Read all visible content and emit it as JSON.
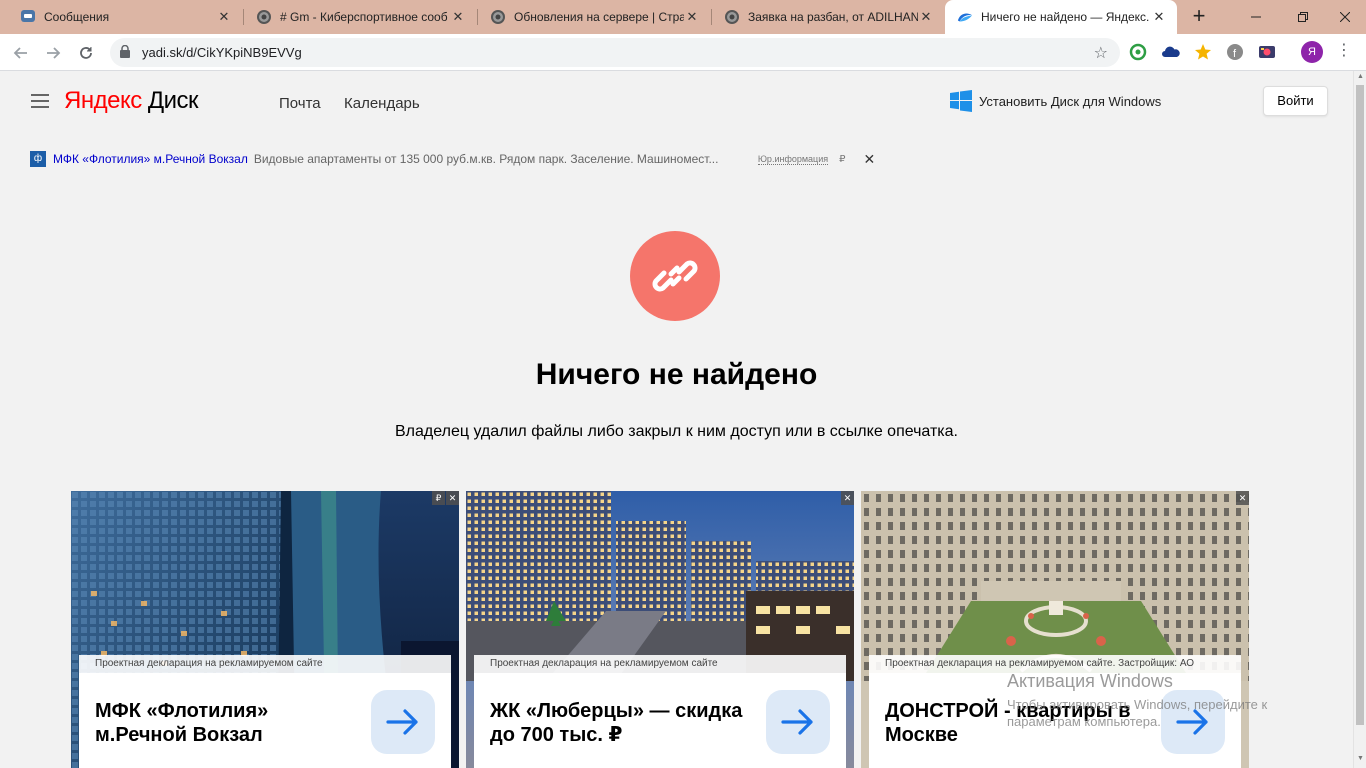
{
  "browser": {
    "tabs": [
      {
        "title": "Сообщения",
        "icon": "chat-icon"
      },
      {
        "title": "# Gm - Киберспортивное сооб",
        "icon": "globe-icon"
      },
      {
        "title": "Обновления на сервере | Стра",
        "icon": "globe-icon"
      },
      {
        "title": "Заявка на разбан, от ADILHAN",
        "icon": "globe-icon"
      },
      {
        "title": "Ничего не найдено — Яндекс.",
        "icon": "yandex-disk-icon",
        "active": true
      }
    ],
    "url": "yadi.sk/d/CikYKpiNB9EVVg",
    "profile_initial": "Я",
    "accent": "#dcb5a4"
  },
  "header": {
    "logo_yandex": "Яндекс",
    "logo_disk": "Диск",
    "nav": [
      "Почта",
      "Календарь"
    ],
    "install_label": "Установить Диск для Windows",
    "login_label": "Войти"
  },
  "text_ad": {
    "favicon_letter": "ф",
    "title": "МФК «Флотилия» м.Речной Вокзал",
    "text": "Видовые апартаменты от 135 000 руб.м.кв. Рядом парк. Заселение. Машиномест...",
    "info": "Юр.информация",
    "currency": "₽",
    "close": "✕"
  },
  "message": {
    "title": "Ничего не найдено",
    "subtitle": "Владелец удалил файлы либо закрыл к ним доступ или в ссылке опечатка.",
    "icon_color": "#f5756b"
  },
  "cards": [
    {
      "declaration": "Проектная декларация на рекламируемом сайте",
      "title": "МФК «Флотилия» м.Речной Вокзал",
      "badges": [
        "₽",
        "✕"
      ]
    },
    {
      "declaration": "Проектная декларация на рекламируемом сайте",
      "title": "ЖК «Люберцы» — скидка до 700 тыс. ₽",
      "badges": [
        "✕"
      ]
    },
    {
      "declaration": "Проектная декларация на рекламируемом сайте. Застройщик: АО",
      "title": "ДОНСТРОЙ - квартиры в Москве",
      "badges": [
        "✕"
      ]
    }
  ],
  "watermark": {
    "title": "Активация Windows",
    "text": "Чтобы активировать Windows, перейдите к параметрам компьютера."
  }
}
